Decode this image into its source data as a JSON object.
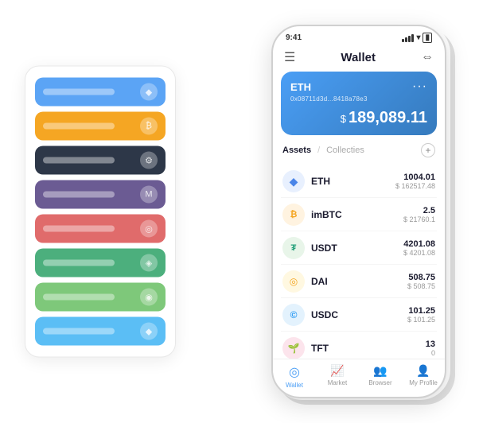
{
  "scene": {
    "background": "#ffffff"
  },
  "cardStack": {
    "cards": [
      {
        "color": "blue",
        "class": "card-blue"
      },
      {
        "color": "orange",
        "class": "card-orange"
      },
      {
        "color": "dark",
        "class": "card-dark"
      },
      {
        "color": "purple",
        "class": "card-purple"
      },
      {
        "color": "red",
        "class": "card-red"
      },
      {
        "color": "green",
        "class": "card-green"
      },
      {
        "color": "light-green",
        "class": "card-light-green"
      },
      {
        "color": "sky",
        "class": "card-sky"
      }
    ]
  },
  "phone": {
    "statusBar": {
      "time": "9:41"
    },
    "header": {
      "menuIcon": "☰",
      "title": "Wallet",
      "expandIcon": "⇔"
    },
    "ethCard": {
      "title": "ETH",
      "address": "0x08711d3d...8418a78e3",
      "dots": "···",
      "balanceSymbol": "$",
      "balance": "189,089.11"
    },
    "assetsSection": {
      "tabActive": "Assets",
      "divider": "/",
      "tabInactive": "Collecties",
      "addIcon": "+"
    },
    "assets": [
      {
        "name": "ETH",
        "icon": "◆",
        "iconClass": "icon-eth",
        "amountPrimary": "1004.01",
        "amountSecondary": "$ 162517.48"
      },
      {
        "name": "imBTC",
        "icon": "₿",
        "iconClass": "icon-imbtc",
        "amountPrimary": "2.5",
        "amountSecondary": "$ 21760.1"
      },
      {
        "name": "USDT",
        "icon": "₮",
        "iconClass": "icon-usdt",
        "amountPrimary": "4201.08",
        "amountSecondary": "$ 4201.08"
      },
      {
        "name": "DAI",
        "icon": "◎",
        "iconClass": "icon-dai",
        "amountPrimary": "508.75",
        "amountSecondary": "$ 508.75"
      },
      {
        "name": "USDC",
        "icon": "©",
        "iconClass": "icon-usdc",
        "amountPrimary": "101.25",
        "amountSecondary": "$ 101.25"
      },
      {
        "name": "TFT",
        "icon": "🌱",
        "iconClass": "icon-tft",
        "amountPrimary": "13",
        "amountSecondary": "0"
      }
    ],
    "nav": [
      {
        "label": "Wallet",
        "icon": "◎",
        "active": true
      },
      {
        "label": "Market",
        "icon": "📊",
        "active": false
      },
      {
        "label": "Browser",
        "icon": "👤",
        "active": false
      },
      {
        "label": "My Profile",
        "icon": "👤",
        "active": false
      }
    ]
  }
}
